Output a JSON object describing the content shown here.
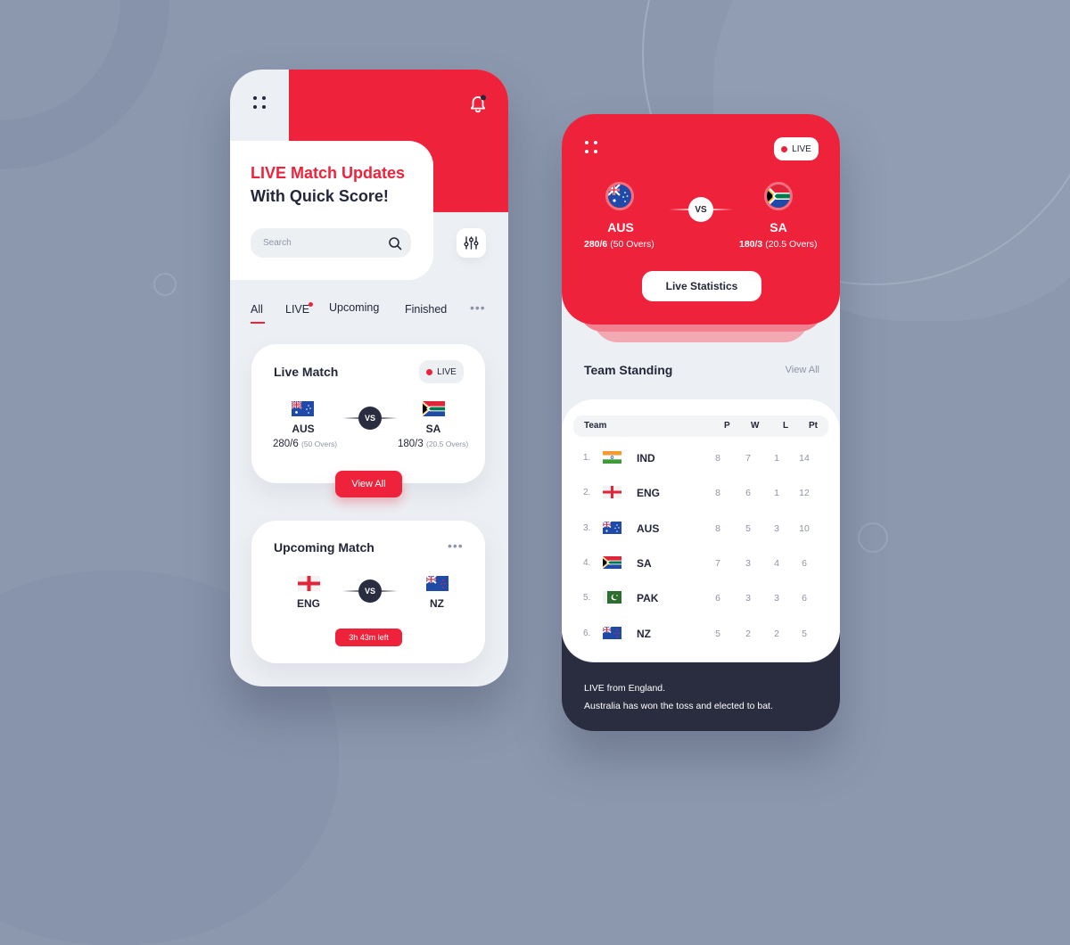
{
  "colors": {
    "accent": "#ee223b",
    "dark": "#242739",
    "muted": "#8e95a7",
    "background": "#8c98ae",
    "panel": "#eceff3"
  },
  "home": {
    "hero_line1": "LIVE Match Updates",
    "hero_line2": "With Quick Score!",
    "search_placeholder": "Search",
    "tabs": [
      {
        "label": "All",
        "active": true
      },
      {
        "label": "LIVE",
        "has_dot": true
      },
      {
        "label": "Upcoming"
      },
      {
        "label": "Finished"
      }
    ],
    "more_label": "•••",
    "live_match": {
      "title": "Live Match",
      "badge": "LIVE",
      "team1": {
        "code": "AUS",
        "score": "280/6",
        "overs": "(50 Overs)",
        "flag": "australia"
      },
      "team2": {
        "code": "SA",
        "score": "180/3",
        "overs": "(20.5 Overs)",
        "flag": "south-africa"
      },
      "vs": "VS",
      "button": "View All"
    },
    "upcoming_match": {
      "title": "Upcoming Match",
      "more": "•••",
      "team1": {
        "code": "ENG",
        "flag": "england"
      },
      "team2": {
        "code": "NZ",
        "flag": "new-zealand"
      },
      "vs": "VS",
      "countdown": "3h 43m left"
    }
  },
  "detail": {
    "badge": "LIVE",
    "team1": {
      "code": "AUS",
      "score": "280/6",
      "overs": "(50 Overs)",
      "flag": "australia"
    },
    "team2": {
      "code": "SA",
      "score": "180/3",
      "overs": "(20.5 Overs)",
      "flag": "south-africa"
    },
    "vs": "VS",
    "button": "Live Statistics",
    "standing_title": "Team Standing",
    "view_all": "View All",
    "columns": [
      "Team",
      "P",
      "W",
      "L",
      "Pt"
    ],
    "rows": [
      {
        "rank": "1.",
        "code": "IND",
        "flag": "india",
        "p": "8",
        "w": "7",
        "l": "1",
        "pt": "14"
      },
      {
        "rank": "2.",
        "code": "ENG",
        "flag": "england",
        "p": "8",
        "w": "6",
        "l": "1",
        "pt": "12"
      },
      {
        "rank": "3.",
        "code": "AUS",
        "flag": "australia",
        "p": "8",
        "w": "5",
        "l": "3",
        "pt": "10"
      },
      {
        "rank": "4.",
        "code": "SA",
        "flag": "south-africa",
        "p": "7",
        "w": "3",
        "l": "4",
        "pt": "6"
      },
      {
        "rank": "5.",
        "code": "PAK",
        "flag": "pakistan",
        "p": "6",
        "w": "3",
        "l": "3",
        "pt": "6"
      },
      {
        "rank": "6.",
        "code": "NZ",
        "flag": "new-zealand",
        "p": "5",
        "w": "2",
        "l": "2",
        "pt": "5"
      }
    ],
    "footer_line1": "LIVE from England.",
    "footer_line2": "Australia has won the toss and elected to bat."
  }
}
